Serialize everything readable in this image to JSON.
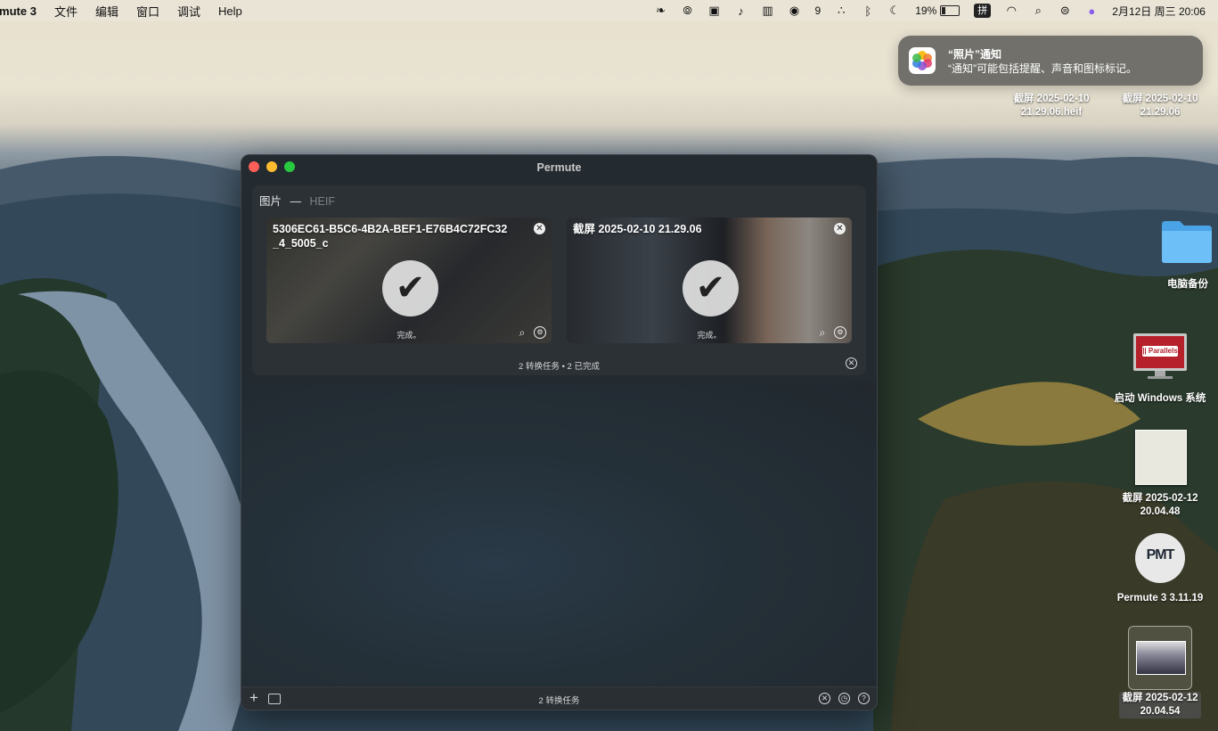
{
  "menubar": {
    "app_name": "rmute 3",
    "menus": [
      "文件",
      "编辑",
      "窗口",
      "调试",
      "Help"
    ],
    "wechat_count": "9",
    "battery": "19%",
    "input_method": "拼",
    "datetime": "2月12日 周三  20:06"
  },
  "notification": {
    "title": "“照片”通知",
    "body": "“通知”可能包括提醒、声音和图标标记。"
  },
  "desktop": {
    "file1": "截屏 2025-02-10\n21.29.06.heif",
    "file2": "截屏 2025-02-10\n21.29.06",
    "folder_label": "电脑备份",
    "parallels_label": "启动 Windows 系统",
    "parallels_logo": "|| Parallels",
    "shot1": "截屏 2025-02-12\n20.04.48",
    "permute_label": "Permute 3 3.11.19",
    "permute_logo": "PMT",
    "shot2": "截屏 2025-02-12\n20.04.54"
  },
  "window": {
    "title": "Permute",
    "panel": {
      "type_label": "图片",
      "separator": "—",
      "format_label": "HEIF",
      "summary": "2 转换任务 • 2 已完成",
      "cards": [
        {
          "title": "5306EC61-B5C6-4B2A-BEF1-E76B4C72FC32_4_5005_c",
          "status": "完成。"
        },
        {
          "title": "截屏 2025-02-10 21.29.06",
          "status": "完成。"
        }
      ]
    },
    "footer": {
      "task_count": "2 转换任务"
    }
  },
  "colors": {
    "close": "#ff5f57",
    "minimize": "#febc2e",
    "zoom": "#28c840",
    "folder": "#5fb3f0"
  }
}
